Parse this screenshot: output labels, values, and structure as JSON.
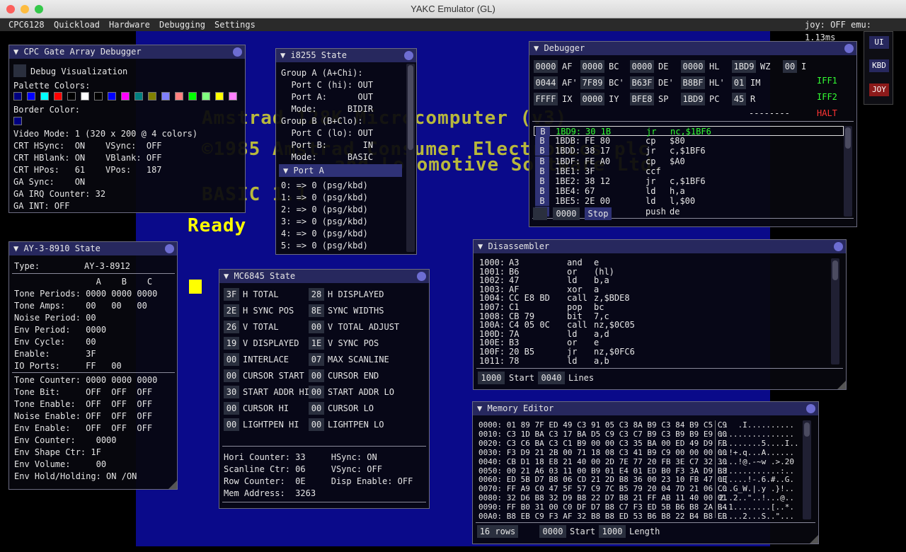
{
  "window": {
    "title": "YAKC Emulator (GL)"
  },
  "menu": {
    "items": [
      "CPC6128",
      "Quickload",
      "Hardware",
      "Debugging",
      "Settings"
    ],
    "status": "joy: OFF emu: 1.13ms"
  },
  "side_buttons": {
    "ui": "UI",
    "kbd": "KBD",
    "joy": "JOY"
  },
  "cpc_screen": {
    "line1": "Amstrad 128K Microcomputer (v3)",
    "line2": "©1985 Amstrad Consumer Electronics plc",
    "line3": "and Locomotive Software Ltd.",
    "line4": "BASIC 1.1",
    "line5": "Ready"
  },
  "gate_array": {
    "title": "CPC Gate Array Debugger",
    "debug_vis": "Debug Visualization",
    "palette_label": "Palette Colors:",
    "palette": [
      "#000080",
      "#0000ff",
      "#00ffff",
      "#ff0000",
      "#000000",
      "#ffffff",
      "#000000",
      "#0000ff",
      "#ff00ff",
      "#008080",
      "#808000",
      "#8080ff",
      "#ff8080",
      "#00ff00",
      "#80ff80",
      "#ffff00",
      "#ff80ff"
    ],
    "border_label": "Border Color:",
    "border_color": "#000080",
    "lines": [
      "Video Mode: 1 (320 x 200 @ 4 colors)",
      "CRT HSync:  ON    VSync:  OFF",
      "CRT HBlank: ON    VBlank: OFF",
      "CRT HPos:   61    VPos:   187",
      "GA Sync:    ON",
      "GA IRQ Counter: 32",
      "GA INT: OFF"
    ]
  },
  "i8255": {
    "title": "i8255 State",
    "lines": [
      "Group A (A+Chi):",
      "  Port C (hi): OUT",
      "  Port A:      OUT",
      "  Mode:      BIDIR",
      "Group B (B+Clo):",
      "  Port C (lo): OUT",
      "  Port B:       IN",
      "  Mode:      BASIC"
    ],
    "porta_header": "Port A",
    "porta_lines": [
      "0: => 0 (psg/kbd)",
      "1: => 0 (psg/kbd)",
      "2: => 0 (psg/kbd)",
      "3: => 0 (psg/kbd)",
      "4: => 0 (psg/kbd)",
      "5: => 0 (psg/kbd)"
    ]
  },
  "ay": {
    "title": "AY-3-8910 State",
    "type_label": "Type:",
    "type_value": "AY-3-8912",
    "header": "                A    B    C",
    "lines1": [
      "Tone Periods: 0000 0000 0000",
      "Tone Amps:    00   00   00",
      "Noise Period: 00",
      "Env Period:   0000",
      "Env Cycle:    00",
      "Enable:       3F",
      "IO Ports:     FF   00"
    ],
    "lines2": [
      "Tone Counter: 0000 0000 0000",
      "Tone Bit:     OFF  OFF  OFF",
      "Tone Enable:  OFF  OFF  OFF",
      "Noise Enable: OFF  OFF  OFF",
      "Env Enable:   OFF  OFF  OFF",
      "Env Counter:    0000",
      "Env Shape Ctr: 1F",
      "Env Volume:     00",
      "Env Hold/Holding: ON /ON"
    ]
  },
  "mc6845": {
    "title": "MC6845 State",
    "regs": [
      {
        "v": "3F",
        "l": "H TOTAL"
      },
      {
        "v": "28",
        "l": "H DISPLAYED"
      },
      {
        "v": "2E",
        "l": "H SYNC POS"
      },
      {
        "v": "8E",
        "l": "SYNC WIDTHS"
      },
      {
        "v": "26",
        "l": "V TOTAL"
      },
      {
        "v": "00",
        "l": "V TOTAL ADJUST"
      },
      {
        "v": "19",
        "l": "V DISPLAYED"
      },
      {
        "v": "1E",
        "l": "V SYNC POS"
      },
      {
        "v": "00",
        "l": "INTERLACE"
      },
      {
        "v": "07",
        "l": "MAX SCANLINE"
      },
      {
        "v": "00",
        "l": "CURSOR START"
      },
      {
        "v": "00",
        "l": "CURSOR END"
      },
      {
        "v": "30",
        "l": "START ADDR HI"
      },
      {
        "v": "00",
        "l": "START ADDR LO"
      },
      {
        "v": "00",
        "l": "CURSOR HI"
      },
      {
        "v": "00",
        "l": "CURSOR LO"
      },
      {
        "v": "00",
        "l": "LIGHTPEN HI"
      },
      {
        "v": "00",
        "l": "LIGHTPEN LO"
      }
    ],
    "lines": [
      "Hori Counter: 33     HSync: ON",
      "Scanline Ctr: 06     VSync: OFF",
      "Row Counter:  0E     Disp Enable: OFF",
      "Mem Address:  3263"
    ]
  },
  "debugger": {
    "title": "Debugger",
    "regs": [
      [
        {
          "v": "0000",
          "l": "AF"
        },
        {
          "v": "0000",
          "l": "BC"
        },
        {
          "v": "0000",
          "l": "DE"
        },
        {
          "v": "0000",
          "l": "HL"
        },
        {
          "v": "1BD9",
          "l": "WZ"
        },
        {
          "v": "00",
          "l": "I"
        }
      ],
      [
        {
          "v": "0044",
          "l": "AF'"
        },
        {
          "v": "7F89",
          "l": "BC'"
        },
        {
          "v": "B63F",
          "l": "DE'"
        },
        {
          "v": "B8BF",
          "l": "HL'"
        },
        {
          "v": "01",
          "l": "IM"
        }
      ],
      [
        {
          "v": "FFFF",
          "l": "IX"
        },
        {
          "v": "0000",
          "l": "IY"
        },
        {
          "v": "BFE8",
          "l": "SP"
        },
        {
          "v": "1BD9",
          "l": "PC"
        },
        {
          "v": "45",
          "l": "R"
        }
      ]
    ],
    "flags": "--------",
    "iff1": "IFF1",
    "iff2": "IFF2",
    "halt": "HALT",
    "bp": "B",
    "code": [
      {
        "a": "1BD9:",
        "b": "30 1B",
        "m": "jr",
        "o": "nc,$1BF6"
      },
      {
        "a": "1BDB:",
        "b": "FE 80",
        "m": "cp",
        "o": "$80"
      },
      {
        "a": "1BDD:",
        "b": "38 17",
        "m": "jr",
        "o": "c,$1BF6"
      },
      {
        "a": "1BDF:",
        "b": "FE A0",
        "m": "cp",
        "o": "$A0"
      },
      {
        "a": "1BE1:",
        "b": "3F",
        "m": "ccf",
        "o": ""
      },
      {
        "a": "1BE2:",
        "b": "38 12",
        "m": "jr",
        "o": "c,$1BF6"
      },
      {
        "a": "1BE4:",
        "b": "67",
        "m": "ld",
        "o": "h,a"
      },
      {
        "a": "1BE5:",
        "b": "2E 00",
        "m": "ld",
        "o": "l,$00"
      },
      {
        "a": "1BE7:",
        "b": "D5",
        "m": "push",
        "o": "de"
      }
    ],
    "addr_value": "0000",
    "stop_label": "Stop"
  },
  "disasm": {
    "title": "Disassembler",
    "lines": [
      {
        "a": "1000:",
        "b": "A3",
        "m": "and",
        "o": "e"
      },
      {
        "a": "1001:",
        "b": "B6",
        "m": "or",
        "o": "(hl)"
      },
      {
        "a": "1002:",
        "b": "47",
        "m": "ld",
        "o": "b,a"
      },
      {
        "a": "1003:",
        "b": "AF",
        "m": "xor",
        "o": "a"
      },
      {
        "a": "1004:",
        "b": "CC E8 BD",
        "m": "call",
        "o": "z,$BDE8"
      },
      {
        "a": "1007:",
        "b": "C1",
        "m": "pop",
        "o": "bc"
      },
      {
        "a": "1008:",
        "b": "CB 79",
        "m": "bit",
        "o": "7,c"
      },
      {
        "a": "100A:",
        "b": "C4 05 0C",
        "m": "call",
        "o": "nz,$0C05"
      },
      {
        "a": "100D:",
        "b": "7A",
        "m": "ld",
        "o": "a,d"
      },
      {
        "a": "100E:",
        "b": "B3",
        "m": "or",
        "o": "e"
      },
      {
        "a": "100F:",
        "b": "20 B5",
        "m": "jr",
        "o": "nz,$0FC6"
      },
      {
        "a": "1011:",
        "b": "78",
        "m": "ld",
        "o": "a,b"
      }
    ],
    "start_value": "1000",
    "start_label": "Start",
    "lines_value": "0040",
    "lines_label": "Lines"
  },
  "memory": {
    "title": "Memory Editor",
    "rows": [
      {
        "h": "0000: 01 89 7F ED 49 C3 91 05 C3 8A B9 C3 84 B9 C5 C9",
        "a": "..  .I.........."
      },
      {
        "h": "0010: C3 1D BA C3 17 BA D5 C9 C3 C7 B9 C3 B9 B9 E9 00",
        "a": "................"
      },
      {
        "h": "0020: C3 C6 BA C3 C1 B9 00 00 C3 35 BA 00 ED 49 D9 FB",
        "a": ".........5....I.."
      },
      {
        "h": "0030: F3 D9 21 2B 00 71 18 08 C3 41 B9 C9 00 00 00 00",
        "a": "..!+.q...A......"
      },
      {
        "h": "0040: CB D1 18 E8 21 40 00 2D 7E 77 20 FB 3E C7 32 30",
        "a": "....!@.-~w .>.20"
      },
      {
        "h": "0050: 00 21 A6 03 11 00 B9 01 E4 01 ED B0 F3 3A D9 B8",
        "a": ".!...........:.."
      },
      {
        "h": "0060: ED 5B D7 B8 06 CD 21 2D B8 36 00 23 10 FB 47 0E",
        "a": ".[....!-.6.#..G."
      },
      {
        "h": "0070: FF A9 C0 47 5F 57 C9 7C B5 79 20 04 7D 21 06 C0",
        "a": "...G_W.|.y .}!.."
      },
      {
        "h": "0080: 32 D6 B8 32 D9 B8 22 D7 B8 21 FF AB 11 40 00 01",
        "a": "2..2..\"..!...@.."
      },
      {
        "h": "0090: FF B0 31 00 C0 DF D7 B8 C7 F3 ED 5B B6 B8 2A B4",
        "a": "..1........[..*."
      },
      {
        "h": "00A0: B8 EB C9 F3 AF 32 B8 B8 ED 53 B6 B8 22 B4 B8 EB",
        "a": ".....2...S..\"..."
      }
    ],
    "rows_label": "16 rows",
    "start_value": "0000",
    "start_label": "Start",
    "length_value": "1000",
    "length_label": "Length"
  }
}
